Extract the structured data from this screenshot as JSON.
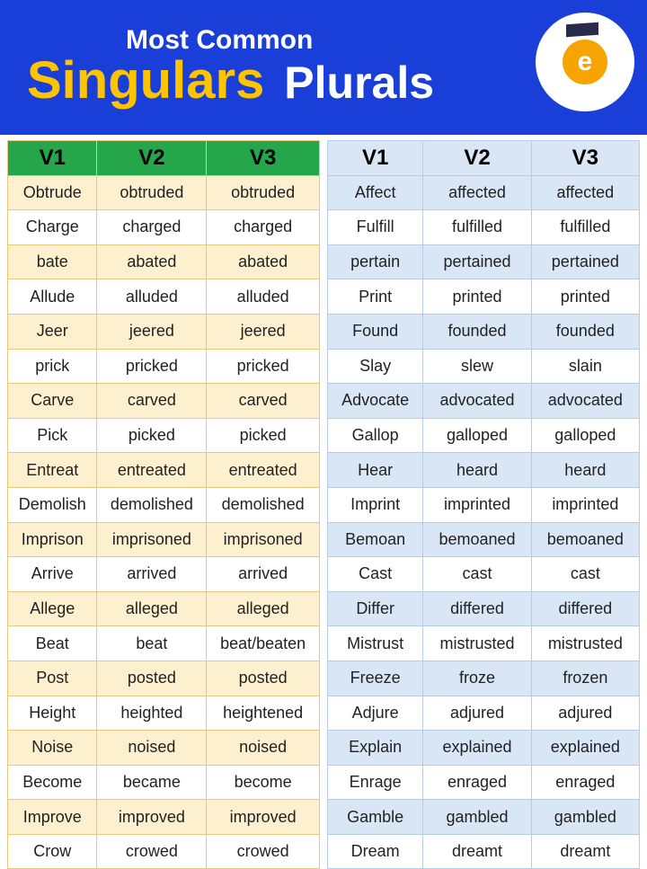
{
  "header": {
    "top": "Most Common",
    "left": "Singulars",
    "right": "Plurals"
  },
  "logo": {
    "letter": "e"
  },
  "leftTable": {
    "headers": [
      "V1",
      "V2",
      "V3"
    ],
    "rows": [
      [
        "Obtrude",
        "obtruded",
        "obtruded"
      ],
      [
        "Charge",
        "charged",
        "charged"
      ],
      [
        "bate",
        "abated",
        "abated"
      ],
      [
        "Allude",
        "alluded",
        "alluded"
      ],
      [
        "Jeer",
        "jeered",
        "jeered"
      ],
      [
        "prick",
        "pricked",
        "pricked"
      ],
      [
        "Carve",
        "carved",
        "carved"
      ],
      [
        "Pick",
        "picked",
        "picked"
      ],
      [
        "Entreat",
        "entreated",
        "entreated"
      ],
      [
        "Demolish",
        "demolished",
        "demolished"
      ],
      [
        "Imprison",
        "imprisoned",
        "imprisoned"
      ],
      [
        "Arrive",
        "arrived",
        "arrived"
      ],
      [
        "Allege",
        "alleged",
        "alleged"
      ],
      [
        "Beat",
        "beat",
        "beat/beaten"
      ],
      [
        "Post",
        "posted",
        "posted"
      ],
      [
        "Height",
        "heighted",
        "heightened"
      ],
      [
        "Noise",
        "noised",
        "noised"
      ],
      [
        "Become",
        "became",
        "become"
      ],
      [
        "Improve",
        "improved",
        "improved"
      ],
      [
        "Crow",
        "crowed",
        "crowed"
      ]
    ]
  },
  "rightTable": {
    "headers": [
      "V1",
      "V2",
      "V3"
    ],
    "rows": [
      [
        "Affect",
        "affected",
        "affected"
      ],
      [
        "Fulfill",
        "fulfilled",
        "fulfilled"
      ],
      [
        "pertain",
        "pertained",
        "pertained"
      ],
      [
        "Print",
        "printed",
        "printed"
      ],
      [
        "Found",
        "founded",
        "founded"
      ],
      [
        "Slay",
        "slew",
        "slain"
      ],
      [
        "Advocate",
        "advocated",
        "advocated"
      ],
      [
        "Gallop",
        "galloped",
        "galloped"
      ],
      [
        "Hear",
        "heard",
        "heard"
      ],
      [
        "Imprint",
        "imprinted",
        "imprinted"
      ],
      [
        "Bemoan",
        "bemoaned",
        "bemoaned"
      ],
      [
        "Cast",
        "cast",
        "cast"
      ],
      [
        "Differ",
        "differed",
        "differed"
      ],
      [
        "Mistrust",
        "mistrusted",
        "mistrusted"
      ],
      [
        "Freeze",
        "froze",
        "frozen"
      ],
      [
        "Adjure",
        "adjured",
        "adjured"
      ],
      [
        "Explain",
        "explained",
        "explained"
      ],
      [
        "Enrage",
        "enraged",
        "enraged"
      ],
      [
        "Gamble",
        "gambled",
        "gambled"
      ],
      [
        "Dream",
        "dreamt",
        "dreamt"
      ]
    ]
  }
}
